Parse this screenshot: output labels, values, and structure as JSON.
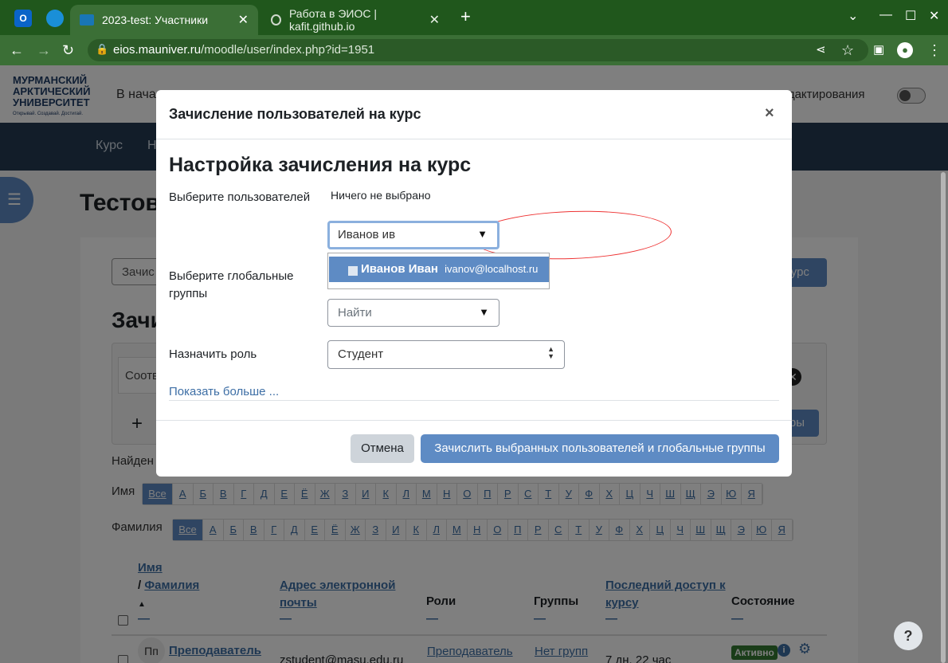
{
  "browser": {
    "tabs": [
      {
        "title": "2023-test: Участники"
      },
      {
        "title": "Работа в ЭИОС | kafit.github.io"
      }
    ],
    "url_host": "eios.mauniver.ru",
    "url_path": "/moodle/user/index.php?id=1951"
  },
  "site": {
    "logo_lines": [
      "МУРМАНСКИЙ",
      "АРКТИЧЕСКИЙ",
      "УНИВЕРСИТЕТ"
    ],
    "logo_tagline": "Открывай. Создавай. Достигай.",
    "home_link": "В начал",
    "edit_mode_label": "м редактирования",
    "nav": [
      "Курс",
      "Н"
    ],
    "page_title": "Тестов",
    "enrol_input_text": "Зачис",
    "enrol_btn_text": "курс",
    "section_title": "Зачи",
    "filter_text": "Соотв",
    "apply_btn_text": "тры",
    "found_text": "Найден",
    "firstname_label": "Имя",
    "lastname_label": "Фамилия",
    "all_label": "Все",
    "letters": [
      "А",
      "Б",
      "В",
      "Г",
      "Д",
      "Е",
      "Ё",
      "Ж",
      "З",
      "И",
      "К",
      "Л",
      "М",
      "Н",
      "О",
      "П",
      "Р",
      "С",
      "Т",
      "У",
      "Ф",
      "Х",
      "Ц",
      "Ч",
      "Ш",
      "Щ",
      "Э",
      "Ю",
      "Я"
    ],
    "table": {
      "col_name_first": "Имя",
      "col_name_slash": "/",
      "col_name_last": "Фамилия",
      "col_email_l1": "Адрес электронной",
      "col_email_l2": "почты",
      "col_roles": "Роли",
      "col_groups": "Группы",
      "col_lastaccess_l1": "Последний доступ к",
      "col_lastaccess_l2": "курсу",
      "col_status": "Состояние",
      "rows": [
        {
          "initials": "Пп",
          "name": "Преподаватель",
          "email": "zstudent@masu.edu.ru",
          "role": "Преподаватель",
          "groups": "Нет групп",
          "last_access": "7 дн. 22 час",
          "status": "Активно"
        }
      ]
    },
    "help": "?"
  },
  "modal": {
    "title": "Зачисление пользователей на курс",
    "close": "×",
    "heading": "Настройка зачисления на курс",
    "select_users_label": "Выберите пользователей",
    "nothing_selected": "Ничего не выбрано",
    "user_search_value": "Иванов ив",
    "suggestion_name": "Иванов Иван",
    "suggestion_email": "ivanov@localhost.ru",
    "cohorts_label_l1": "Выберите глобальные",
    "cohorts_label_l2": "группы",
    "cohorts_placeholder": "Найти",
    "role_label": "Назначить роль",
    "role_value": "Студент",
    "show_more": "Показать больше ...",
    "cancel": "Отмена",
    "submit": "Зачислить выбранных пользователей и глобальные группы"
  }
}
